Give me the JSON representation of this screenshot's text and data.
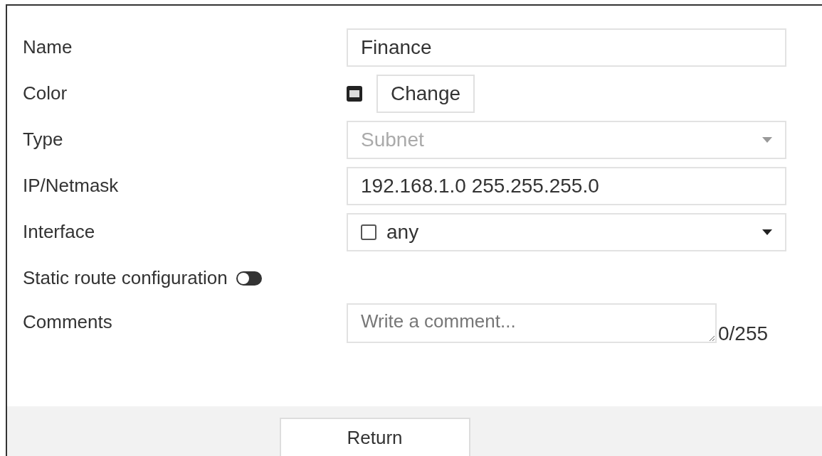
{
  "fields": [
    {
      "kind": "text",
      "label": "Name",
      "value": "Finance"
    },
    {
      "kind": "color",
      "label": "Color",
      "button": "Change"
    },
    {
      "kind": "select",
      "label": "Type",
      "value": "Subnet",
      "disabled": true
    },
    {
      "kind": "text",
      "label": "IP/Netmask",
      "value": "192.168.1.0 255.255.255.0"
    },
    {
      "kind": "interface",
      "label": "Interface",
      "value": "any",
      "disabled": false
    },
    {
      "kind": "toggle",
      "label": "Static route configuration",
      "on": false
    },
    {
      "kind": "textarea",
      "label": "Comments",
      "placeholder": "Write a comment...",
      "counter": "0/255"
    }
  ],
  "footer": {
    "button": "Return"
  }
}
